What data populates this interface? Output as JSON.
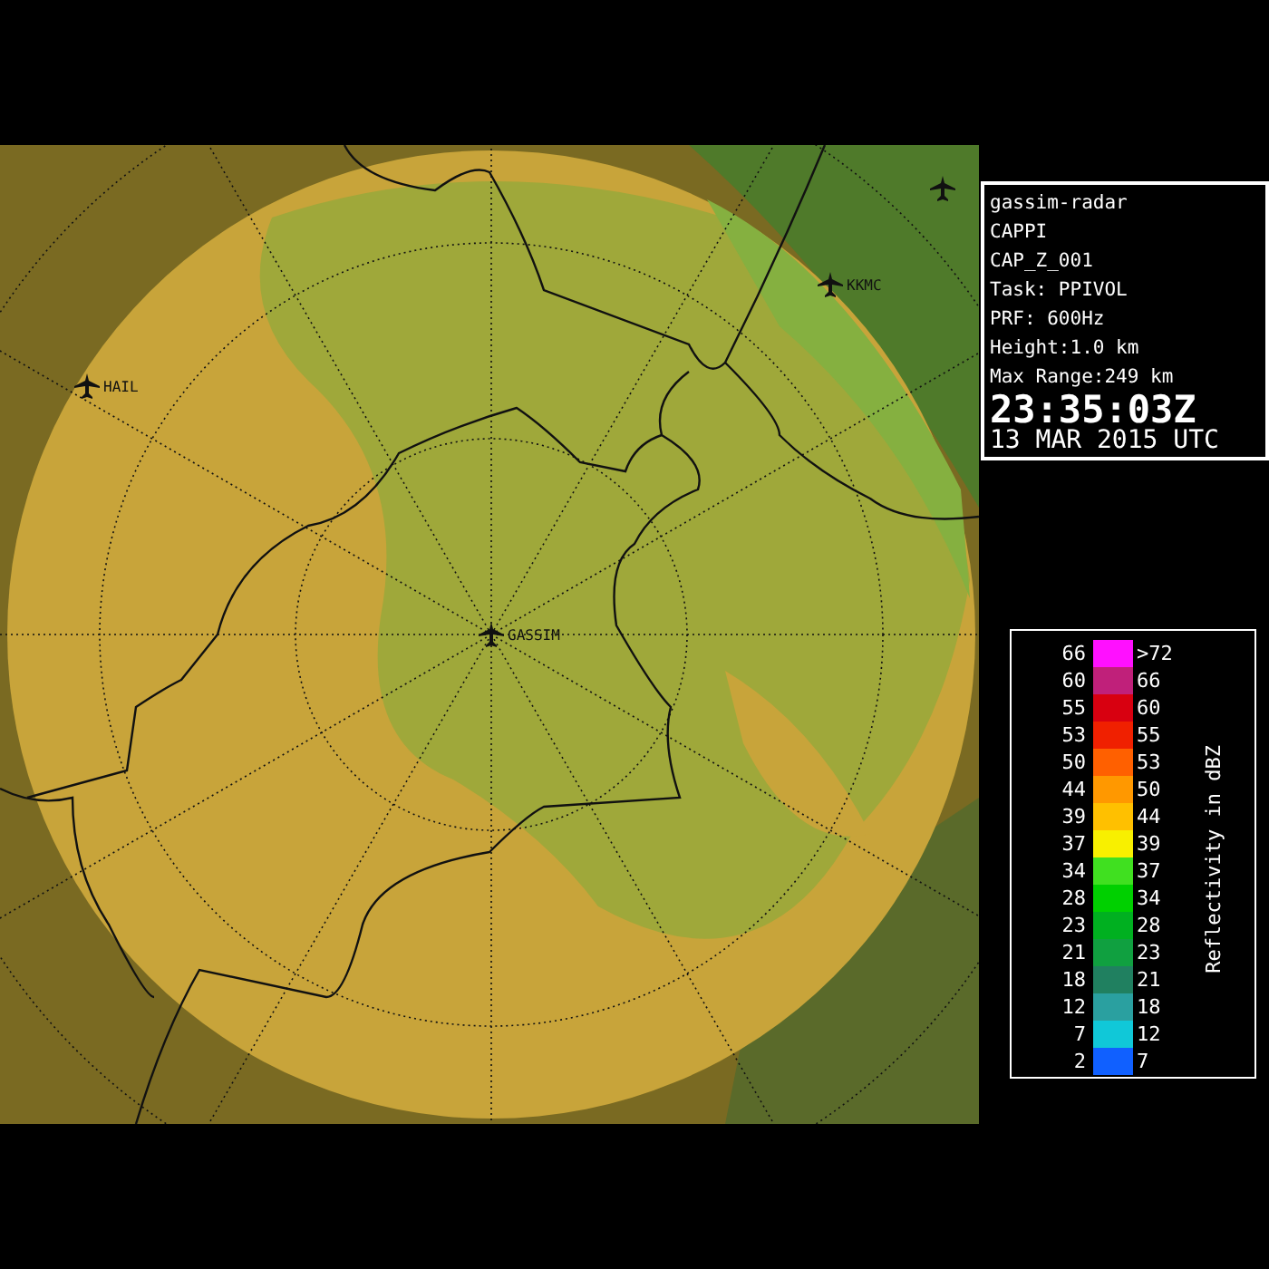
{
  "map": {
    "airports": [
      {
        "kind": "labeled",
        "label": "GASSIM"
      },
      {
        "kind": "labeled",
        "label": "HAIL"
      },
      {
        "kind": "labeled",
        "label": "KKMC"
      },
      {
        "kind": "marker"
      }
    ]
  },
  "info": {
    "lines": [
      "gassim-radar",
      "CAPPI",
      "CAP_Z_001",
      "Task: PPIVOL",
      "PRF: 600Hz",
      "Height:1.0 km",
      "Max Range:249 km"
    ],
    "time": "23:35:03Z",
    "date": "13 MAR 2015 UTC"
  },
  "legend": {
    "title": "Reflectivity in dBZ",
    "rows": [
      {
        "low": "66",
        "high": ">72",
        "color": "#ff10ff"
      },
      {
        "low": "60",
        "high": "66",
        "color": "#c0207a"
      },
      {
        "low": "55",
        "high": "60",
        "color": "#d80010"
      },
      {
        "low": "53",
        "high": "55",
        "color": "#f02000"
      },
      {
        "low": "50",
        "high": "53",
        "color": "#ff6000"
      },
      {
        "low": "44",
        "high": "50",
        "color": "#ff9800"
      },
      {
        "low": "39",
        "high": "44",
        "color": "#ffc000"
      },
      {
        "low": "37",
        "high": "39",
        "color": "#f8f000"
      },
      {
        "low": "34",
        "high": "37",
        "color": "#40e020"
      },
      {
        "low": "28",
        "high": "34",
        "color": "#00d000"
      },
      {
        "low": "23",
        "high": "28",
        "color": "#00b020"
      },
      {
        "low": "21",
        "high": "23",
        "color": "#10a040"
      },
      {
        "low": "18",
        "high": "21",
        "color": "#208060"
      },
      {
        "low": "12",
        "high": "18",
        "color": "#2aa0a0"
      },
      {
        "low": "7",
        "high": "12",
        "color": "#10c8d8"
      },
      {
        "low": "2",
        "high": "7",
        "color": "#1060ff"
      }
    ]
  }
}
